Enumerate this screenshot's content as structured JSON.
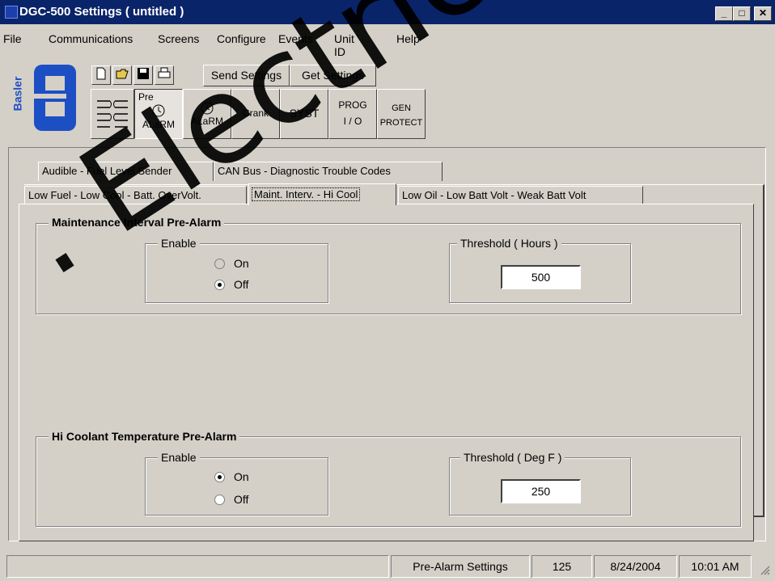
{
  "window": {
    "title": "DGC-500 Settings   ( untitled )"
  },
  "menu": [
    "File",
    "Communications",
    "Screens",
    "Configure",
    "Events",
    "Unit ID",
    "Help"
  ],
  "toolbar": {
    "logo_text": "Basler",
    "send_label": "Send Settings",
    "get_label": "Get Settings",
    "screens": [
      {
        "line1": "Pre",
        "line2": "ALaRM"
      },
      {
        "line1": "",
        "line2": "ALaRM"
      },
      {
        "line1": "",
        "line2": "Crank"
      },
      {
        "line1": "",
        "line2": "SYST"
      },
      {
        "line1": "PROG",
        "line2": "I / O"
      },
      {
        "line1": "GEN",
        "line2": "PROTECT"
      }
    ]
  },
  "tabs": {
    "row1": [
      "Audible -  Fuel Level Sender",
      "CAN Bus - Diagnostic Trouble Codes"
    ],
    "row2": [
      "Low Fuel - Low Cool - Batt. OverVolt.",
      "Maint. Interv. - Hi Cool",
      "Low Oil - Low Batt  Volt - Weak Batt Volt"
    ],
    "selected": "Maint. Interv. - Hi Cool"
  },
  "maint": {
    "title": "Maintenance Interval Pre-Alarm",
    "enable_label": "Enable",
    "on_label": "On",
    "off_label": "Off",
    "selected": "Off",
    "threshold_label": "Threshold ( Hours )",
    "threshold_value": "500"
  },
  "coolant": {
    "title": "Hi Coolant Temperature Pre-Alarm",
    "enable_label": "Enable",
    "on_label": "On",
    "off_label": "Off",
    "selected": "On",
    "threshold_label": "Threshold ( Deg F )",
    "threshold_value": "250"
  },
  "status": {
    "screen": "Pre-Alarm Settings",
    "number": "125",
    "date": "8/24/2004",
    "time": "10:01 AM"
  },
  "watermark": ". Electrical"
}
